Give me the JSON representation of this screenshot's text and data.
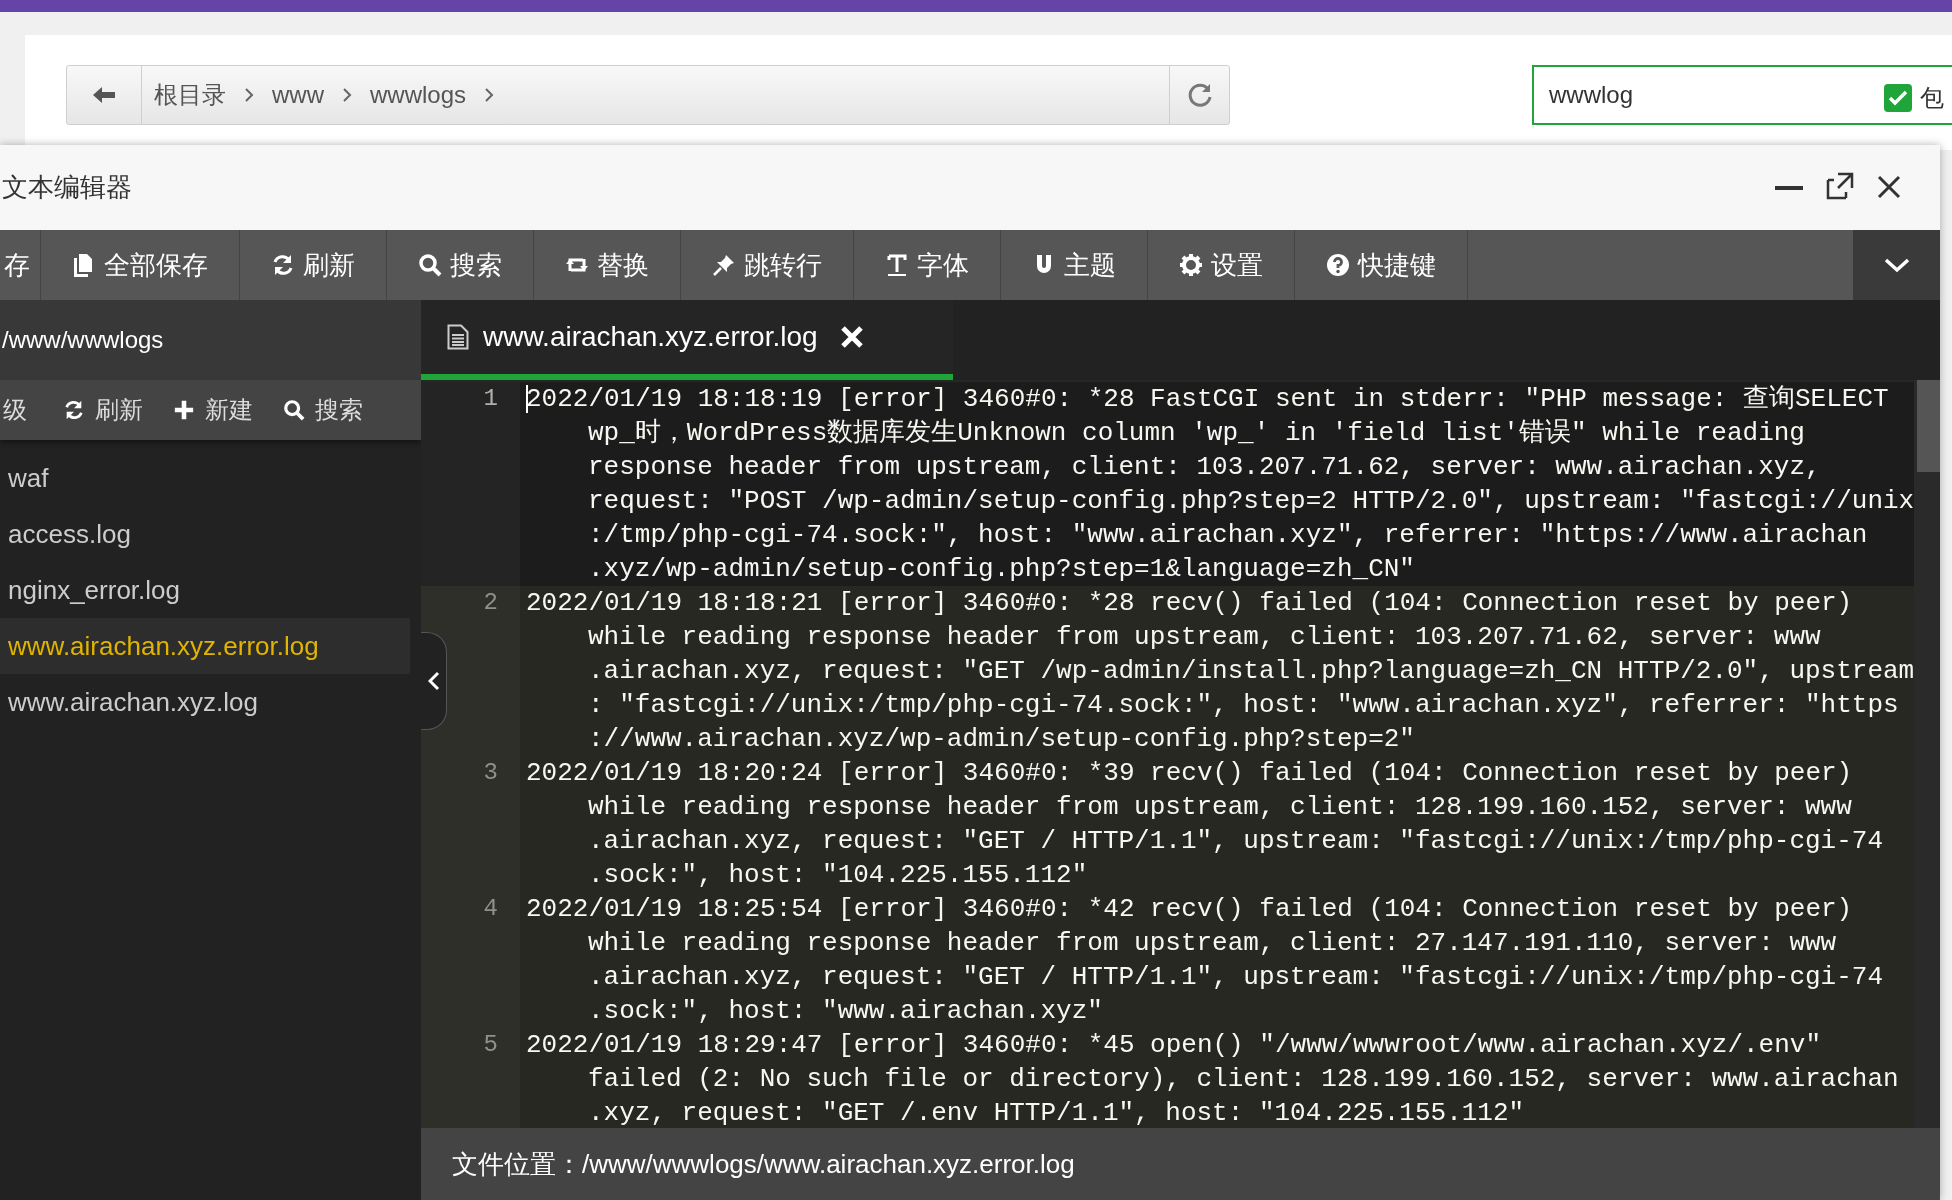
{
  "top_bar": {
    "breadcrumb": [
      "根目录",
      "www",
      "wwwlogs"
    ],
    "search": {
      "value": "wwwlog"
    },
    "include_checkbox": {
      "label": "包",
      "checked": true
    }
  },
  "editor": {
    "title": "文本编辑器",
    "toolbar": [
      "存",
      "全部保存",
      "刷新",
      "搜索",
      "替换",
      "跳转行",
      "字体",
      "主题",
      "设置",
      "快捷键"
    ],
    "sidebar": {
      "path": "/www/wwwlogs",
      "actions": [
        "级",
        "刷新",
        "新建",
        "搜索"
      ],
      "files": [
        {
          "name": "waf",
          "selected": false
        },
        {
          "name": "access.log",
          "selected": false
        },
        {
          "name": "nginx_error.log",
          "selected": false
        },
        {
          "name": "www.airachan.xyz.error.log",
          "selected": true
        },
        {
          "name": "www.airachan.xyz.log",
          "selected": false
        }
      ]
    },
    "tab": {
      "label": "www.airachan.xyz.error.log"
    },
    "lines": [
      {
        "number": "1",
        "active": true,
        "rows": [
          "2022/01/19 18:18:19 [error] 3460#0: *28 FastCGI sent in stderr: \"PHP message: 查询SELECT",
          "wp_时，WordPress数据库发生Unknown column 'wp_' in 'field list'错误\" while reading",
          "response header from upstream, client: 103.207.71.62, server: www.airachan.xyz,",
          "request: \"POST /wp-admin/setup-config.php?step=2 HTTP/2.0\", upstream: \"fastcgi://unix",
          ":/tmp/php-cgi-74.sock:\", host: \"www.airachan.xyz\", referrer: \"https://www.airachan",
          ".xyz/wp-admin/setup-config.php?step=1&language=zh_CN\""
        ]
      },
      {
        "number": "2",
        "active": false,
        "rows": [
          "2022/01/19 18:18:21 [error] 3460#0: *28 recv() failed (104: Connection reset by peer)",
          "while reading response header from upstream, client: 103.207.71.62, server: www",
          ".airachan.xyz, request: \"GET /wp-admin/install.php?language=zh_CN HTTP/2.0\", upstream",
          ": \"fastcgi://unix:/tmp/php-cgi-74.sock:\", host: \"www.airachan.xyz\", referrer: \"https",
          "://www.airachan.xyz/wp-admin/setup-config.php?step=2\""
        ]
      },
      {
        "number": "3",
        "active": false,
        "rows": [
          "2022/01/19 18:20:24 [error] 3460#0: *39 recv() failed (104: Connection reset by peer)",
          "while reading response header from upstream, client: 128.199.160.152, server: www",
          ".airachan.xyz, request: \"GET / HTTP/1.1\", upstream: \"fastcgi://unix:/tmp/php-cgi-74",
          ".sock:\", host: \"104.225.155.112\""
        ]
      },
      {
        "number": "4",
        "active": false,
        "rows": [
          "2022/01/19 18:25:54 [error] 3460#0: *42 recv() failed (104: Connection reset by peer)",
          "while reading response header from upstream, client: 27.147.191.110, server: www",
          ".airachan.xyz, request: \"GET / HTTP/1.1\", upstream: \"fastcgi://unix:/tmp/php-cgi-74",
          ".sock:\", host: \"www.airachan.xyz\""
        ]
      },
      {
        "number": "5",
        "active": false,
        "rows": [
          "2022/01/19 18:29:47 [error] 3460#0: *45 open() \"/www/wwwroot/www.airachan.xyz/.env\"",
          "failed (2: No such file or directory), client: 128.199.160.152, server: www.airachan",
          ".xyz, request: \"GET /.env HTTP/1.1\", host: \"104.225.155.112\""
        ]
      }
    ],
    "status": "文件位置：/www/wwwlogs/www.airachan.xyz.error.log"
  }
}
